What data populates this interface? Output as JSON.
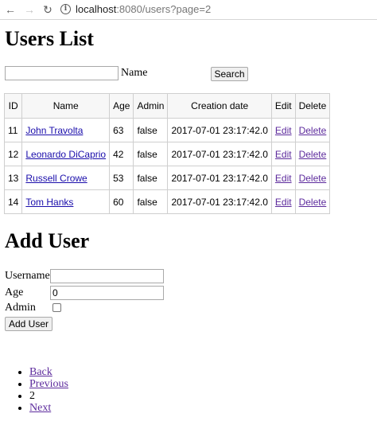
{
  "browser": {
    "url_host": "localhost",
    "url_path": ":8080/users?page=2"
  },
  "users_section": {
    "title": "Users List",
    "search": {
      "value": "",
      "label": "Name",
      "button": "Search"
    },
    "table": {
      "headers": [
        "ID",
        "Name",
        "Age",
        "Admin",
        "Creation date",
        "Edit",
        "Delete"
      ],
      "rows": [
        {
          "id": "11",
          "name": "John Travolta",
          "age": "63",
          "admin": "false",
          "created": "2017-07-01 23:17:42.0",
          "edit": "Edit",
          "delete": "Delete"
        },
        {
          "id": "12",
          "name": "Leonardo DiCaprio",
          "age": "42",
          "admin": "false",
          "created": "2017-07-01 23:17:42.0",
          "edit": "Edit",
          "delete": "Delete"
        },
        {
          "id": "13",
          "name": "Russell Crowe",
          "age": "53",
          "admin": "false",
          "created": "2017-07-01 23:17:42.0",
          "edit": "Edit",
          "delete": "Delete"
        },
        {
          "id": "14",
          "name": "Tom Hanks",
          "age": "60",
          "admin": "false",
          "created": "2017-07-01 23:17:42.0",
          "edit": "Edit",
          "delete": "Delete"
        }
      ]
    }
  },
  "add_user": {
    "title": "Add User",
    "username_label": "Username",
    "username_value": "",
    "age_label": "Age",
    "age_value": "0",
    "admin_label": "Admin",
    "admin_checked": false,
    "button": "Add User"
  },
  "pagination": {
    "back": "Back",
    "previous": "Previous",
    "current": "2",
    "next": "Next"
  },
  "colors": {
    "link": "#1a0dab",
    "visited_link": "#5c2a9c"
  },
  "icons": {
    "back": "arrow-left-icon",
    "forward": "arrow-right-icon",
    "reload": "reload-icon",
    "info": "info-icon"
  }
}
